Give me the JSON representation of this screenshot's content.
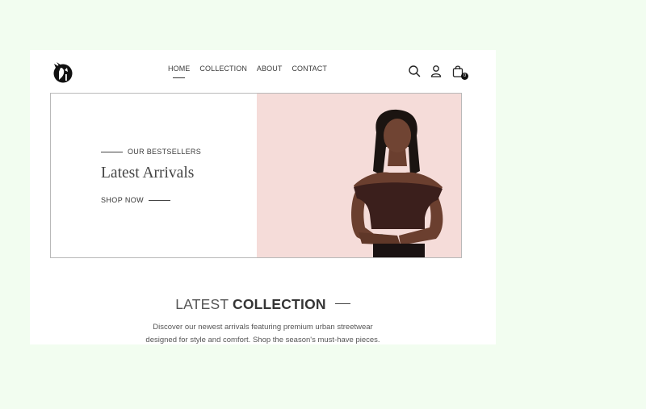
{
  "nav": {
    "items": [
      {
        "label": "HOME",
        "active": true
      },
      {
        "label": "COLLECTION",
        "active": false
      },
      {
        "label": "ABOUT",
        "active": false
      },
      {
        "label": "CONTACT",
        "active": false
      }
    ]
  },
  "header": {
    "icons": [
      "search-icon",
      "user-icon",
      "shopping-bag-icon"
    ],
    "cart_count": "0"
  },
  "hero": {
    "eyebrow": "OUR BESTSELLERS",
    "title": "Latest Arrivals",
    "cta": "SHOP NOW",
    "background_color": "#f5dcd9"
  },
  "collection": {
    "title_light": "LATEST",
    "title_bold": "COLLECTION",
    "description_line1": "Discover our newest arrivals featuring premium urban streetwear",
    "description_line2": "designed for style and comfort. Shop the season's must-have pieces."
  }
}
